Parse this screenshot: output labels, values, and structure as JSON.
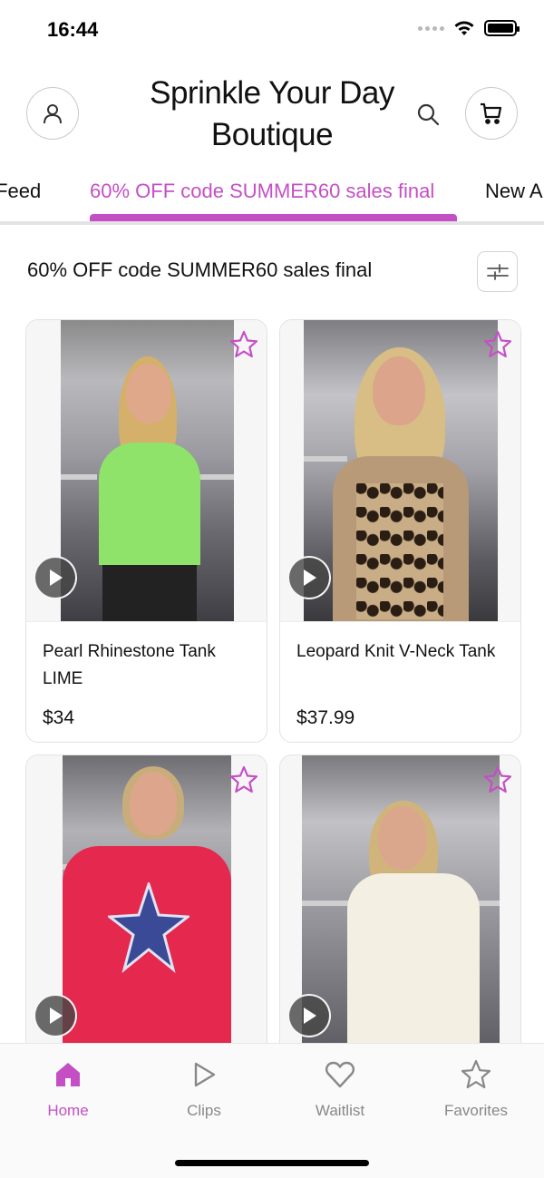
{
  "status_bar": {
    "time": "16:44"
  },
  "header": {
    "title": "Sprinkle Your Day Boutique"
  },
  "tabs": [
    {
      "label": "y Feed",
      "active": false
    },
    {
      "label": "60% OFF code SUMMER60 sales final",
      "active": true
    },
    {
      "label": "New A",
      "active": false
    }
  ],
  "section": {
    "title": "60% OFF code SUMMER60 sales final"
  },
  "products": [
    {
      "name": "Pearl Rhinestone Tank LIME",
      "price": "$34"
    },
    {
      "name": "Leopard Knit V-Neck Tank",
      "price": "$37.99"
    },
    {
      "name": "",
      "price": ""
    },
    {
      "name": "",
      "price": ""
    }
  ],
  "bottom_nav": [
    {
      "label": "Home",
      "icon": "home-icon",
      "active": true
    },
    {
      "label": "Clips",
      "icon": "play-icon",
      "active": false
    },
    {
      "label": "Waitlist",
      "icon": "heart-icon",
      "active": false
    },
    {
      "label": "Favorites",
      "icon": "star-icon",
      "active": false
    }
  ],
  "colors": {
    "accent": "#c44fc5",
    "text": "#111111",
    "muted": "#888888",
    "border": "#e2e2e2"
  }
}
